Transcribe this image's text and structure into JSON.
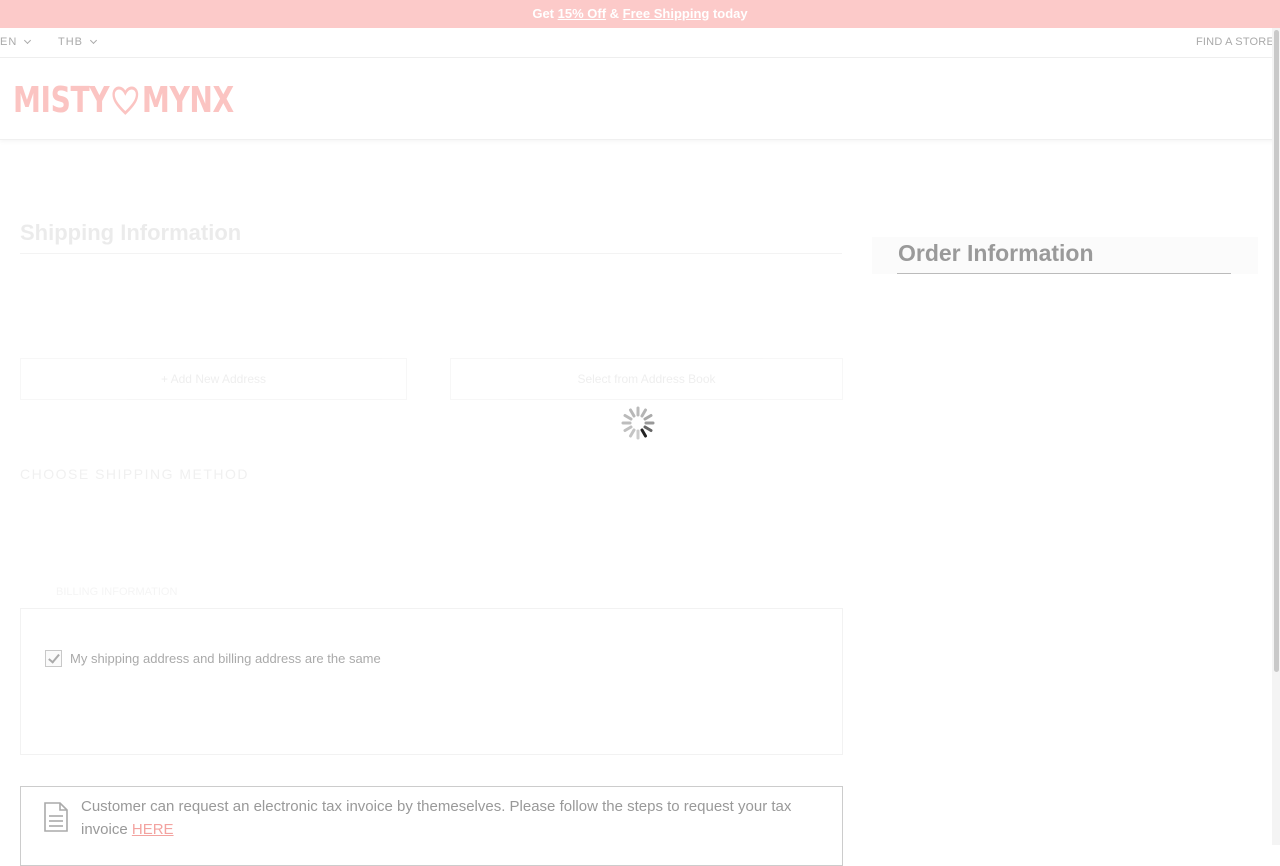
{
  "promo": {
    "prefix": "Get ",
    "discount": "15% Off",
    "joiner": " & ",
    "shipping": "Free Shipping",
    "suffix": " today"
  },
  "topbar": {
    "language": "EN",
    "currency": "THB",
    "find_store": "FIND A STORE"
  },
  "brand": {
    "logo_left": "MISTY",
    "logo_right": "MYNX",
    "color": "#fbc4c2"
  },
  "shipping": {
    "title": "Shipping Information",
    "add_new_address": "+ Add New Address",
    "select_address": "Select from Address Book",
    "method_title": "CHOOSE SHIPPING METHOD",
    "billing_label": "BILLING INFORMATION",
    "same_address_checked": true,
    "same_address_label": "My shipping address and billing address are the same"
  },
  "tax": {
    "text": "Customer can request an electronic tax invoice by themeselves. Please follow the steps to request your tax invoice",
    "link": "HERE"
  },
  "order": {
    "title": "Order Information"
  },
  "colors": {
    "promo_bg": "#fccac9",
    "link": "#f3a3a0"
  }
}
